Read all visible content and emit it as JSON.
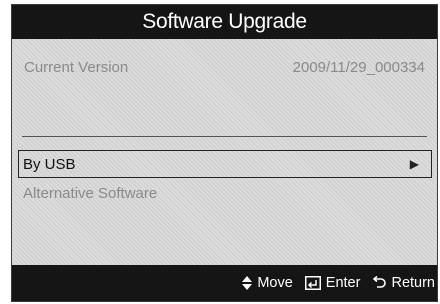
{
  "title": "Software Upgrade",
  "current_version": {
    "label": "Current Version",
    "value": "2009/11/29_000334"
  },
  "menu": {
    "items": [
      {
        "label": "By USB",
        "icon": "play-arrow-icon",
        "state": "selected"
      },
      {
        "label": "Alternative Software",
        "state": "disabled"
      }
    ]
  },
  "footer": {
    "move_label": "Move",
    "enter_label": "Enter",
    "return_label": "Return",
    "icons": [
      "move-updown-icon",
      "enter-icon",
      "return-icon"
    ]
  },
  "colors": {
    "bar_background": "#151515",
    "panel_background": "#dcdcdc",
    "dim_text": "#8a8a8a"
  }
}
